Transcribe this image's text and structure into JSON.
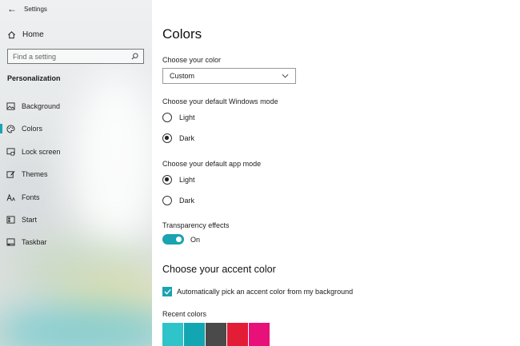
{
  "window": {
    "title": "Settings"
  },
  "sidebar": {
    "home_label": "Home",
    "search_placeholder": "Find a setting",
    "section_title": "Personalization",
    "items": [
      {
        "label": "Background",
        "icon": "picture-icon"
      },
      {
        "label": "Colors",
        "icon": "palette-icon"
      },
      {
        "label": "Lock screen",
        "icon": "lock-screen-icon"
      },
      {
        "label": "Themes",
        "icon": "brush-icon"
      },
      {
        "label": "Fonts",
        "icon": "font-icon"
      },
      {
        "label": "Start",
        "icon": "start-grid-icon"
      },
      {
        "label": "Taskbar",
        "icon": "taskbar-icon"
      }
    ],
    "selected": "Colors"
  },
  "main": {
    "title": "Colors",
    "choose_color": {
      "label": "Choose your color",
      "value": "Custom"
    },
    "windows_mode": {
      "label": "Choose your default Windows mode",
      "options": [
        "Light",
        "Dark"
      ],
      "selected": "Dark"
    },
    "app_mode": {
      "label": "Choose your default app mode",
      "options": [
        "Light",
        "Dark"
      ],
      "selected": "Light"
    },
    "transparency": {
      "label": "Transparency effects",
      "state": "On"
    },
    "accent_title": "Choose your accent color",
    "auto_accent": {
      "label": "Automatically pick an accent color from my background",
      "checked": true
    },
    "recent_colors": {
      "label": "Recent colors",
      "colors": [
        "#2ec4c9",
        "#12a6b2",
        "#4a4a4a",
        "#e31d35",
        "#e8117a"
      ]
    }
  },
  "colors": {
    "accent": "#1aa3b0"
  }
}
